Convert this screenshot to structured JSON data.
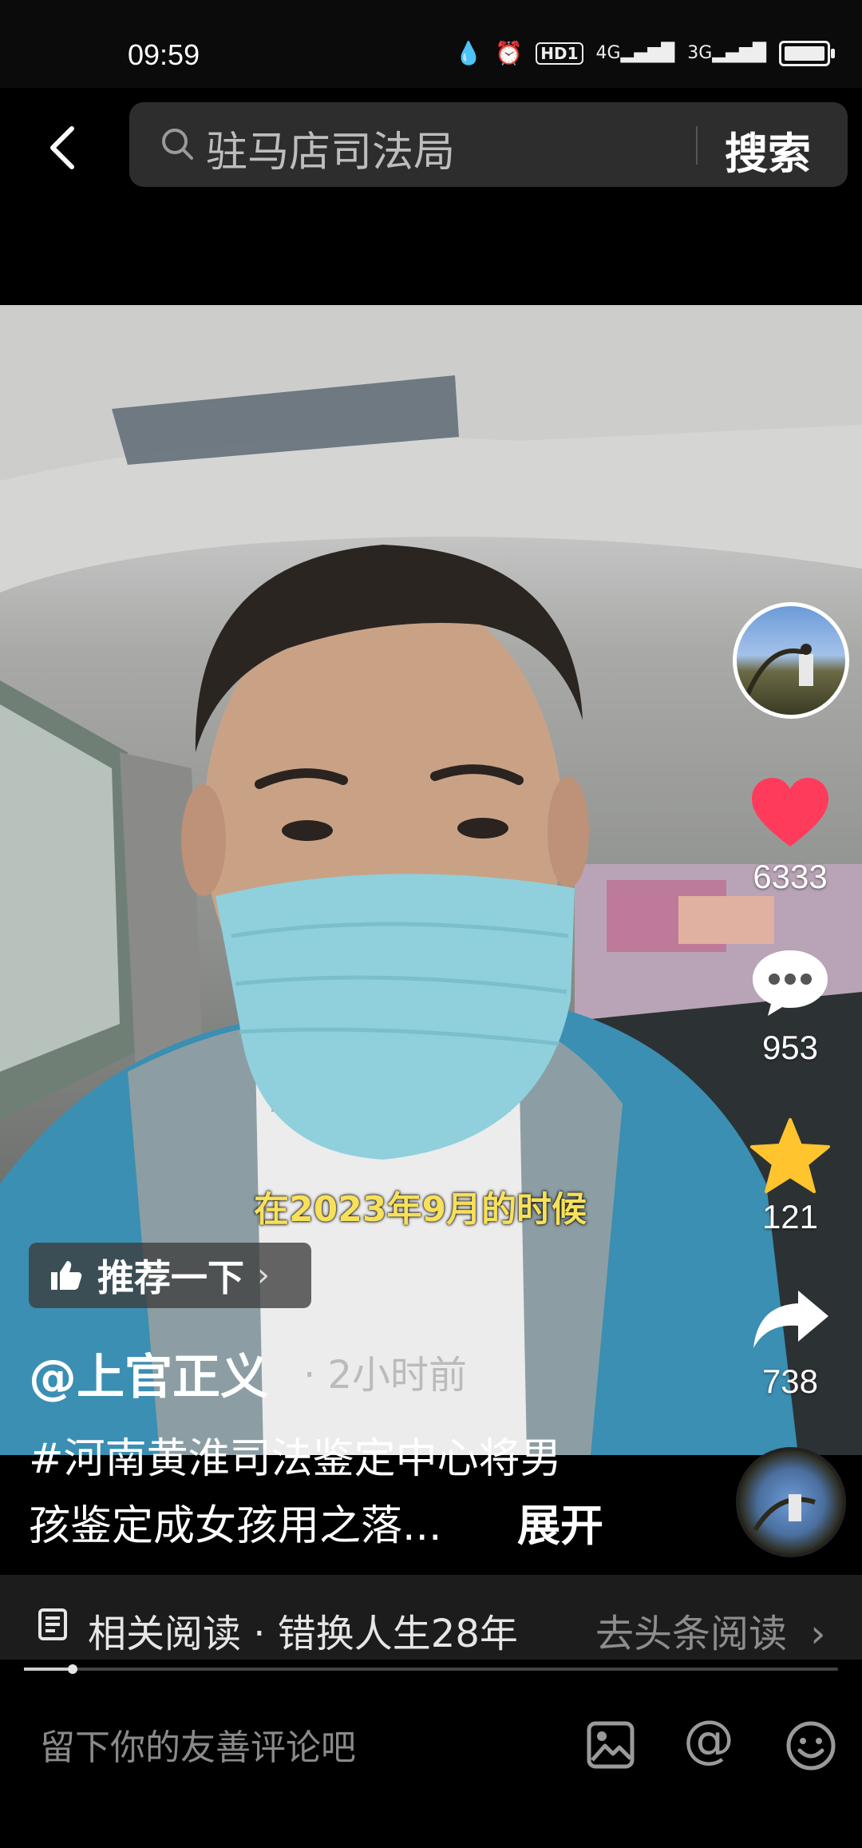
{
  "status_bar": {
    "time": "09:59",
    "hd": "HD1",
    "net1": "4G",
    "net2": "3G"
  },
  "search": {
    "query": "驻马店司法局",
    "button": "搜索"
  },
  "video": {
    "subtitle": "在2023年9月的时候",
    "recommend_label": "推荐一下",
    "author": "@上官正义",
    "time_ago": "· 2小时前",
    "description_line1": "#河南黄淮司法鉴定中心将男",
    "description_line2": "孩鉴定成女孩用之落...",
    "expand_label": "展开"
  },
  "actions": {
    "likes": "6333",
    "comments": "953",
    "favorites": "121",
    "shares": "738"
  },
  "related": {
    "text": "相关阅读 · 错换人生28年",
    "link": "去头条阅读"
  },
  "progress": {
    "fraction": 0.06
  },
  "comment": {
    "placeholder": "留下你的友善评论吧"
  },
  "colors": {
    "like": "#ff3b5c",
    "favorite": "#ffc42e",
    "background": "#000000"
  }
}
